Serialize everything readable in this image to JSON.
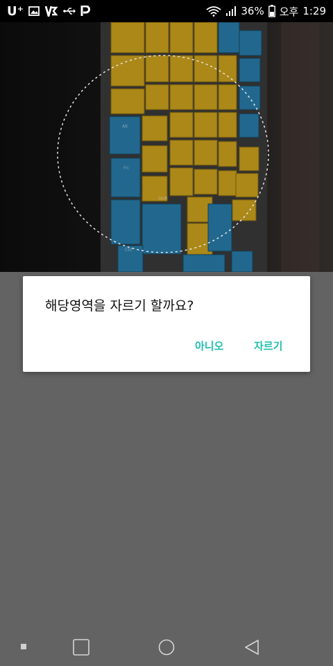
{
  "status_bar": {
    "carrier": "U⁺",
    "battery_percent": "36%",
    "ampm": "오후",
    "time": "1:29",
    "icons": [
      "gallery-icon",
      "v3-icon",
      "usb-icon",
      "p-icon",
      "wifi-icon",
      "signal-icon",
      "battery-icon"
    ]
  },
  "dialog": {
    "message": "해당영역을 자르기 할까요?",
    "no_label": "아니오",
    "crop_label": "자르기"
  },
  "nav": {
    "buttons": [
      "recent-dot",
      "overview-square",
      "home-circle",
      "back-triangle"
    ]
  },
  "colors": {
    "accent": "#1fbfad",
    "overlay": "#636363"
  }
}
